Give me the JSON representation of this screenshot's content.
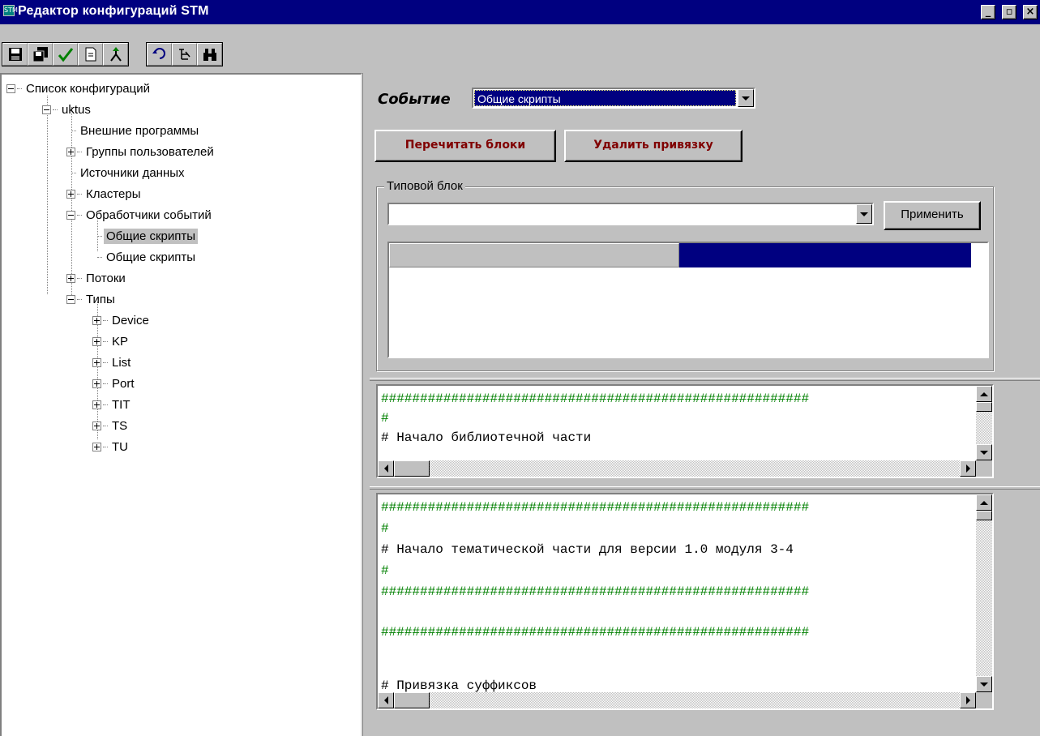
{
  "window": {
    "icon_text": "STM",
    "title": "Редактор конфигураций STM",
    "minimize_label": "_",
    "maximize_label": "▫",
    "close_label": "×"
  },
  "toolbar": {
    "buttons": [
      {
        "icon": "save-icon",
        "color": "#000000"
      },
      {
        "icon": "save-all-icon",
        "color": "#000000"
      },
      {
        "icon": "check-icon",
        "color": "#008000"
      },
      {
        "icon": "document-icon",
        "color": "#000000"
      },
      {
        "icon": "branch-icon",
        "color": "#008000"
      },
      {
        "icon": "undo-icon",
        "color": "#000080"
      },
      {
        "icon": "tree-icon",
        "color": "#000000"
      },
      {
        "icon": "binoculars-icon",
        "color": "#000000"
      }
    ]
  },
  "tree": {
    "root": "Список конфигураций",
    "config": "uktus",
    "items": {
      "external_programs": "Внешние программы",
      "user_groups": "Группы пользователей",
      "data_sources": "Источники данных",
      "clusters": "Кластеры",
      "event_handlers": "Обработчики событий",
      "common_scripts_1": "Общие скрипты",
      "common_scripts_2": "Общие скрипты",
      "streams": "Потоки",
      "types": "Типы"
    },
    "types": [
      "Device",
      "KP",
      "List",
      "Port",
      "TIT",
      "TS",
      "TU"
    ]
  },
  "event": {
    "label": "Событие",
    "selected": "Общие скрипты"
  },
  "buttons": {
    "reread": "Перечитать блоки",
    "unbind": "Удалить привязку",
    "apply": "Применить"
  },
  "typical_block": {
    "title": "Типовой блок",
    "selected": ""
  },
  "editor1": {
    "lines": [
      "#######################################################",
      "#",
      "# Начало библиотечной части"
    ]
  },
  "editor2": {
    "lines": [
      "#######################################################",
      "#",
      "# Начало тематической части для версии 1.0 модуля 3-4",
      "#",
      "#######################################################",
      "",
      "#######################################################",
      "",
      "",
      "# Привязка суффиксов"
    ]
  },
  "colors": {
    "title_bar": "#000080",
    "selection": "#000080",
    "button_text_red": "#800000",
    "code_hash": "#008000"
  }
}
